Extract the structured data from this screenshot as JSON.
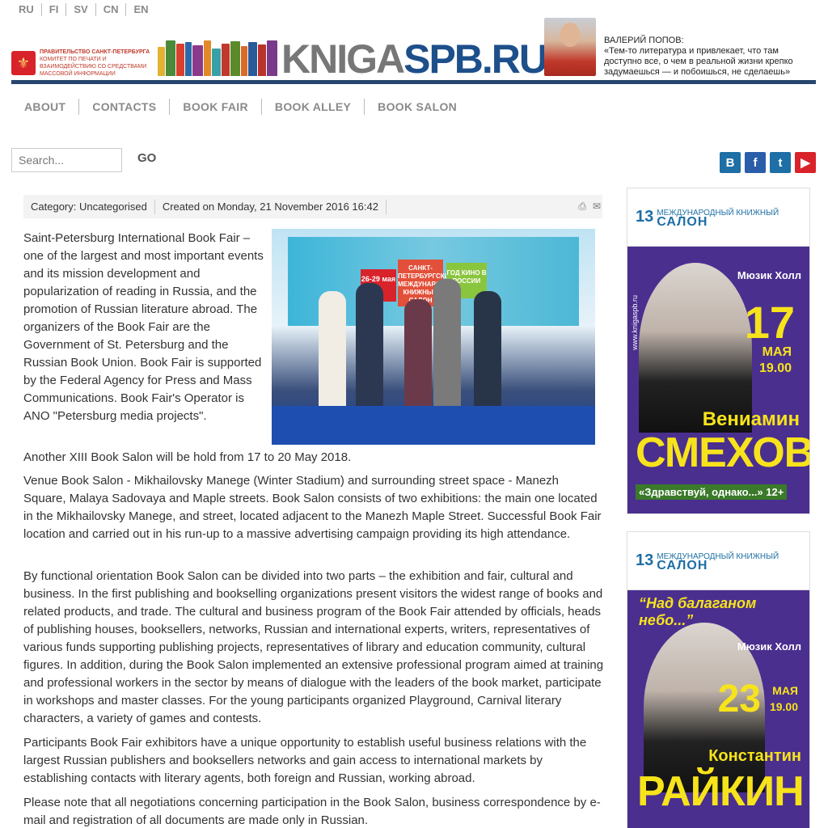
{
  "languages": [
    "RU",
    "FI",
    "SV",
    "CN",
    "EN"
  ],
  "header": {
    "gov_line1": "Правительство Санкт-Петербурга",
    "gov_line2": "Комитет по печати и взаимодействию со средствами массовой информации",
    "logo_part1": "KNIGA",
    "logo_part2": "SPB.RU",
    "quote_author": "ВАЛЕРИЙ ПОПОВ:",
    "quote_text": "«Тем-то литература и привлекает, что там доступно все, о чем в реальной жизни крепко задумаешься — и побоишься, не сделаешь»"
  },
  "nav": [
    "ABOUT",
    "CONTACTS",
    "BOOK FAIR",
    "BOOK ALLEY",
    "BOOK SALON"
  ],
  "search": {
    "placeholder": "Search...",
    "go_label": "GO"
  },
  "social": {
    "vk": "В",
    "fb": "f",
    "tw": "t",
    "yt": "▶"
  },
  "article_meta": {
    "category": "Category: Uncategorised",
    "created": "Created on Monday, 21 November 2016 16:42",
    "print_icon": "printer-icon",
    "email_icon": "email-icon"
  },
  "photo": {
    "badge_dates": "26-29 мая",
    "badge_salon": "САНКТ-ПЕТЕРБУРГСКИЙ МЕЖДУНАРОДНЫЙ КНИЖНЫЙ САЛОН",
    "badge_cinema": "ГОД КИНО В РОССИИ"
  },
  "article": {
    "intro": "Saint-Petersburg International Book Fair – one of the largest and most important events and its mission development and popularization of reading in Russia, and the promotion of Russian literature abroad. The organizers of the Book Fair are the Government of St. Petersburg and the Russian Book Union. Book Fair is supported by the Federal Agency for Press and Mass Communications. Book Fair's Operator is  ANO \"Petersburg media projects\".",
    "p2": "Another XIII Book Salon will be hold from 17 to 20 May 2018.",
    "p3": "Venue Book Salon - Mikhailovsky Manege (Winter Stadium) and surrounding street space - Manezh Square, Malaya Sadovaya  and Maple streets. Book Salon consists of two exhibitions: the main one located in the Mikhailovsky Manege, and street, located adjacent to the Manezh Maple Street. Successful Book Fair location and carried out in his run-up to a massive advertising campaign providing its high attendance.",
    "p4": "By functional orientation Book Salon can be divided into two parts – the exhibition and fair, cultural and business. In the first publishing and bookselling organizations present visitors the widest range of books and related products, and trade. The cultural and business program of the Book Fair attended by officials, heads of publishing houses, booksellers, networks, Russian and international experts, writers, representatives of various funds supporting publishing projects, representatives of library and education community, cultural figures. In addition, during the Book Salon implemented an extensive professional program aimed at training and professional workers in the sector by means of dialogue with the leaders of the book market, participate in workshops and master classes. For the young participants organized Playground, Carnival literary characters, a variety of games and contests.",
    "p5": "Participants Book Fair exhibitors have a unique opportunity to establish useful business relations with the largest Russian publishers and booksellers networks and gain access to international markets by establishing contacts with literary agents, both foreign and Russian, working abroad.",
    "p6": "Please note that all negotiations concerning participation in the Book Salon, business correspondence by e-mail and registration of all documents are made only in Russian."
  },
  "ads": [
    {
      "num": "13",
      "salon_top": "МЕЖДУНАРОДНЫЙ КНИЖНЫЙ",
      "salon_word": "САЛОН",
      "venue": "Мюзик Холл",
      "day": "17",
      "month": "МАЯ",
      "time": "19.00",
      "first_name": "Вениамин",
      "last_name": "СМЕХОВ",
      "subtitle": "«Здравствуй, однако...» 12+",
      "site": "www.knigaspb.ru"
    },
    {
      "num": "13",
      "salon_top": "МЕЖДУНАРОДНЫЙ КНИЖНЫЙ",
      "salon_word": "САЛОН",
      "title": "“Над балаганом небо...”",
      "venue": "Мюзик Холл",
      "day": "23",
      "month": "МАЯ",
      "time": "19.00",
      "first_name": "Константин",
      "last_name": "РАЙКИН"
    }
  ],
  "colors": {
    "header_rule": "#27466f",
    "logo_blue": "#1d4f8a",
    "nav_gray": "#8a8a8a",
    "ad_purple": "#4a2f8f",
    "ad_yellow": "#f7e31b"
  }
}
